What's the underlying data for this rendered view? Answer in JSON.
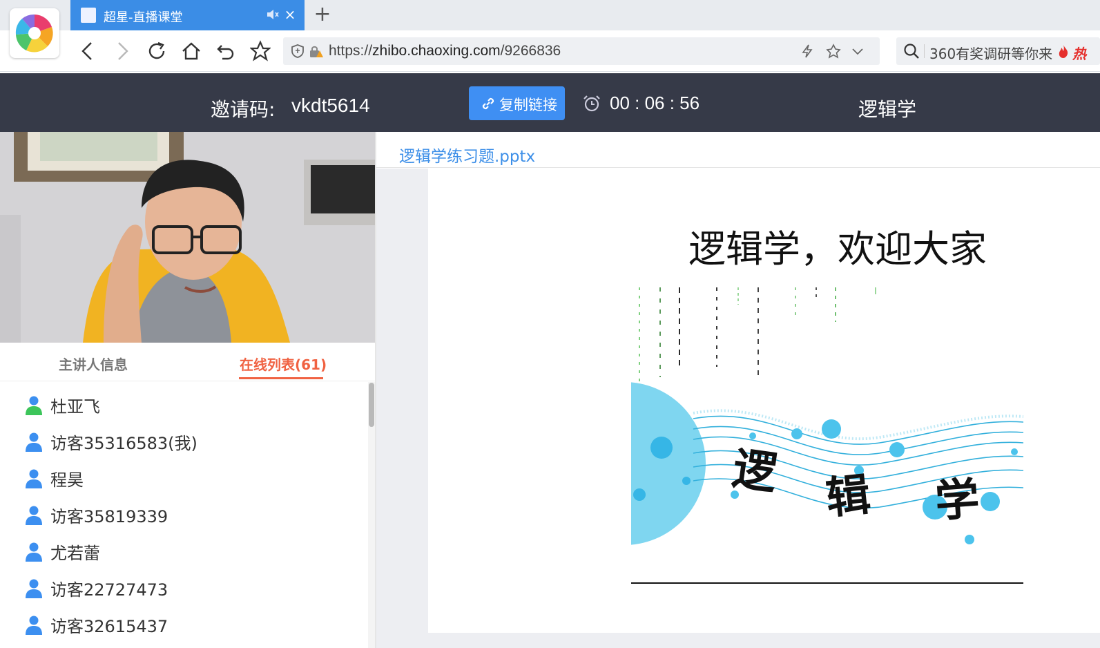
{
  "browser": {
    "tab_title": "超星-直播课堂",
    "tab_close": "×",
    "new_tab": "+",
    "url_prefix": "https://",
    "url_host": "zhibo.chaoxing.com",
    "url_path": "/9266836",
    "search_text": "360有奖调研等你来",
    "search_hot": "热"
  },
  "header": {
    "invite_label": "邀请码:",
    "invite_code": "vkdt5614",
    "copy_link_label": "复制链接",
    "timer": "00 : 06 : 56",
    "course_title": "逻辑学"
  },
  "panel_tabs": {
    "host_info": "主讲人信息",
    "online_list": "在线列表(61)"
  },
  "online_users": [
    {
      "name": "杜亚飞",
      "role": "host"
    },
    {
      "name": "访客35316583(我)",
      "role": "guest"
    },
    {
      "name": "程昊",
      "role": "guest"
    },
    {
      "name": "访客35819339",
      "role": "guest"
    },
    {
      "name": "尤若蕾",
      "role": "guest"
    },
    {
      "name": "访客22727473",
      "role": "guest"
    },
    {
      "name": "访客32615437",
      "role": "guest"
    }
  ],
  "document": {
    "file_name": "逻辑学练习题.pptx",
    "slide_title": "逻辑学，欢迎大家",
    "slide_art_text": [
      "逻",
      "辑",
      "学"
    ]
  },
  "colors": {
    "tab_active": "#3b8de6",
    "header_bg": "#363a48",
    "copy_button": "#3f8ff3",
    "online_tab_accent": "#f06242",
    "host_icon": "#3cc55a",
    "guest_icon": "#3c8ff0",
    "link_blue": "#3d8fe8"
  }
}
